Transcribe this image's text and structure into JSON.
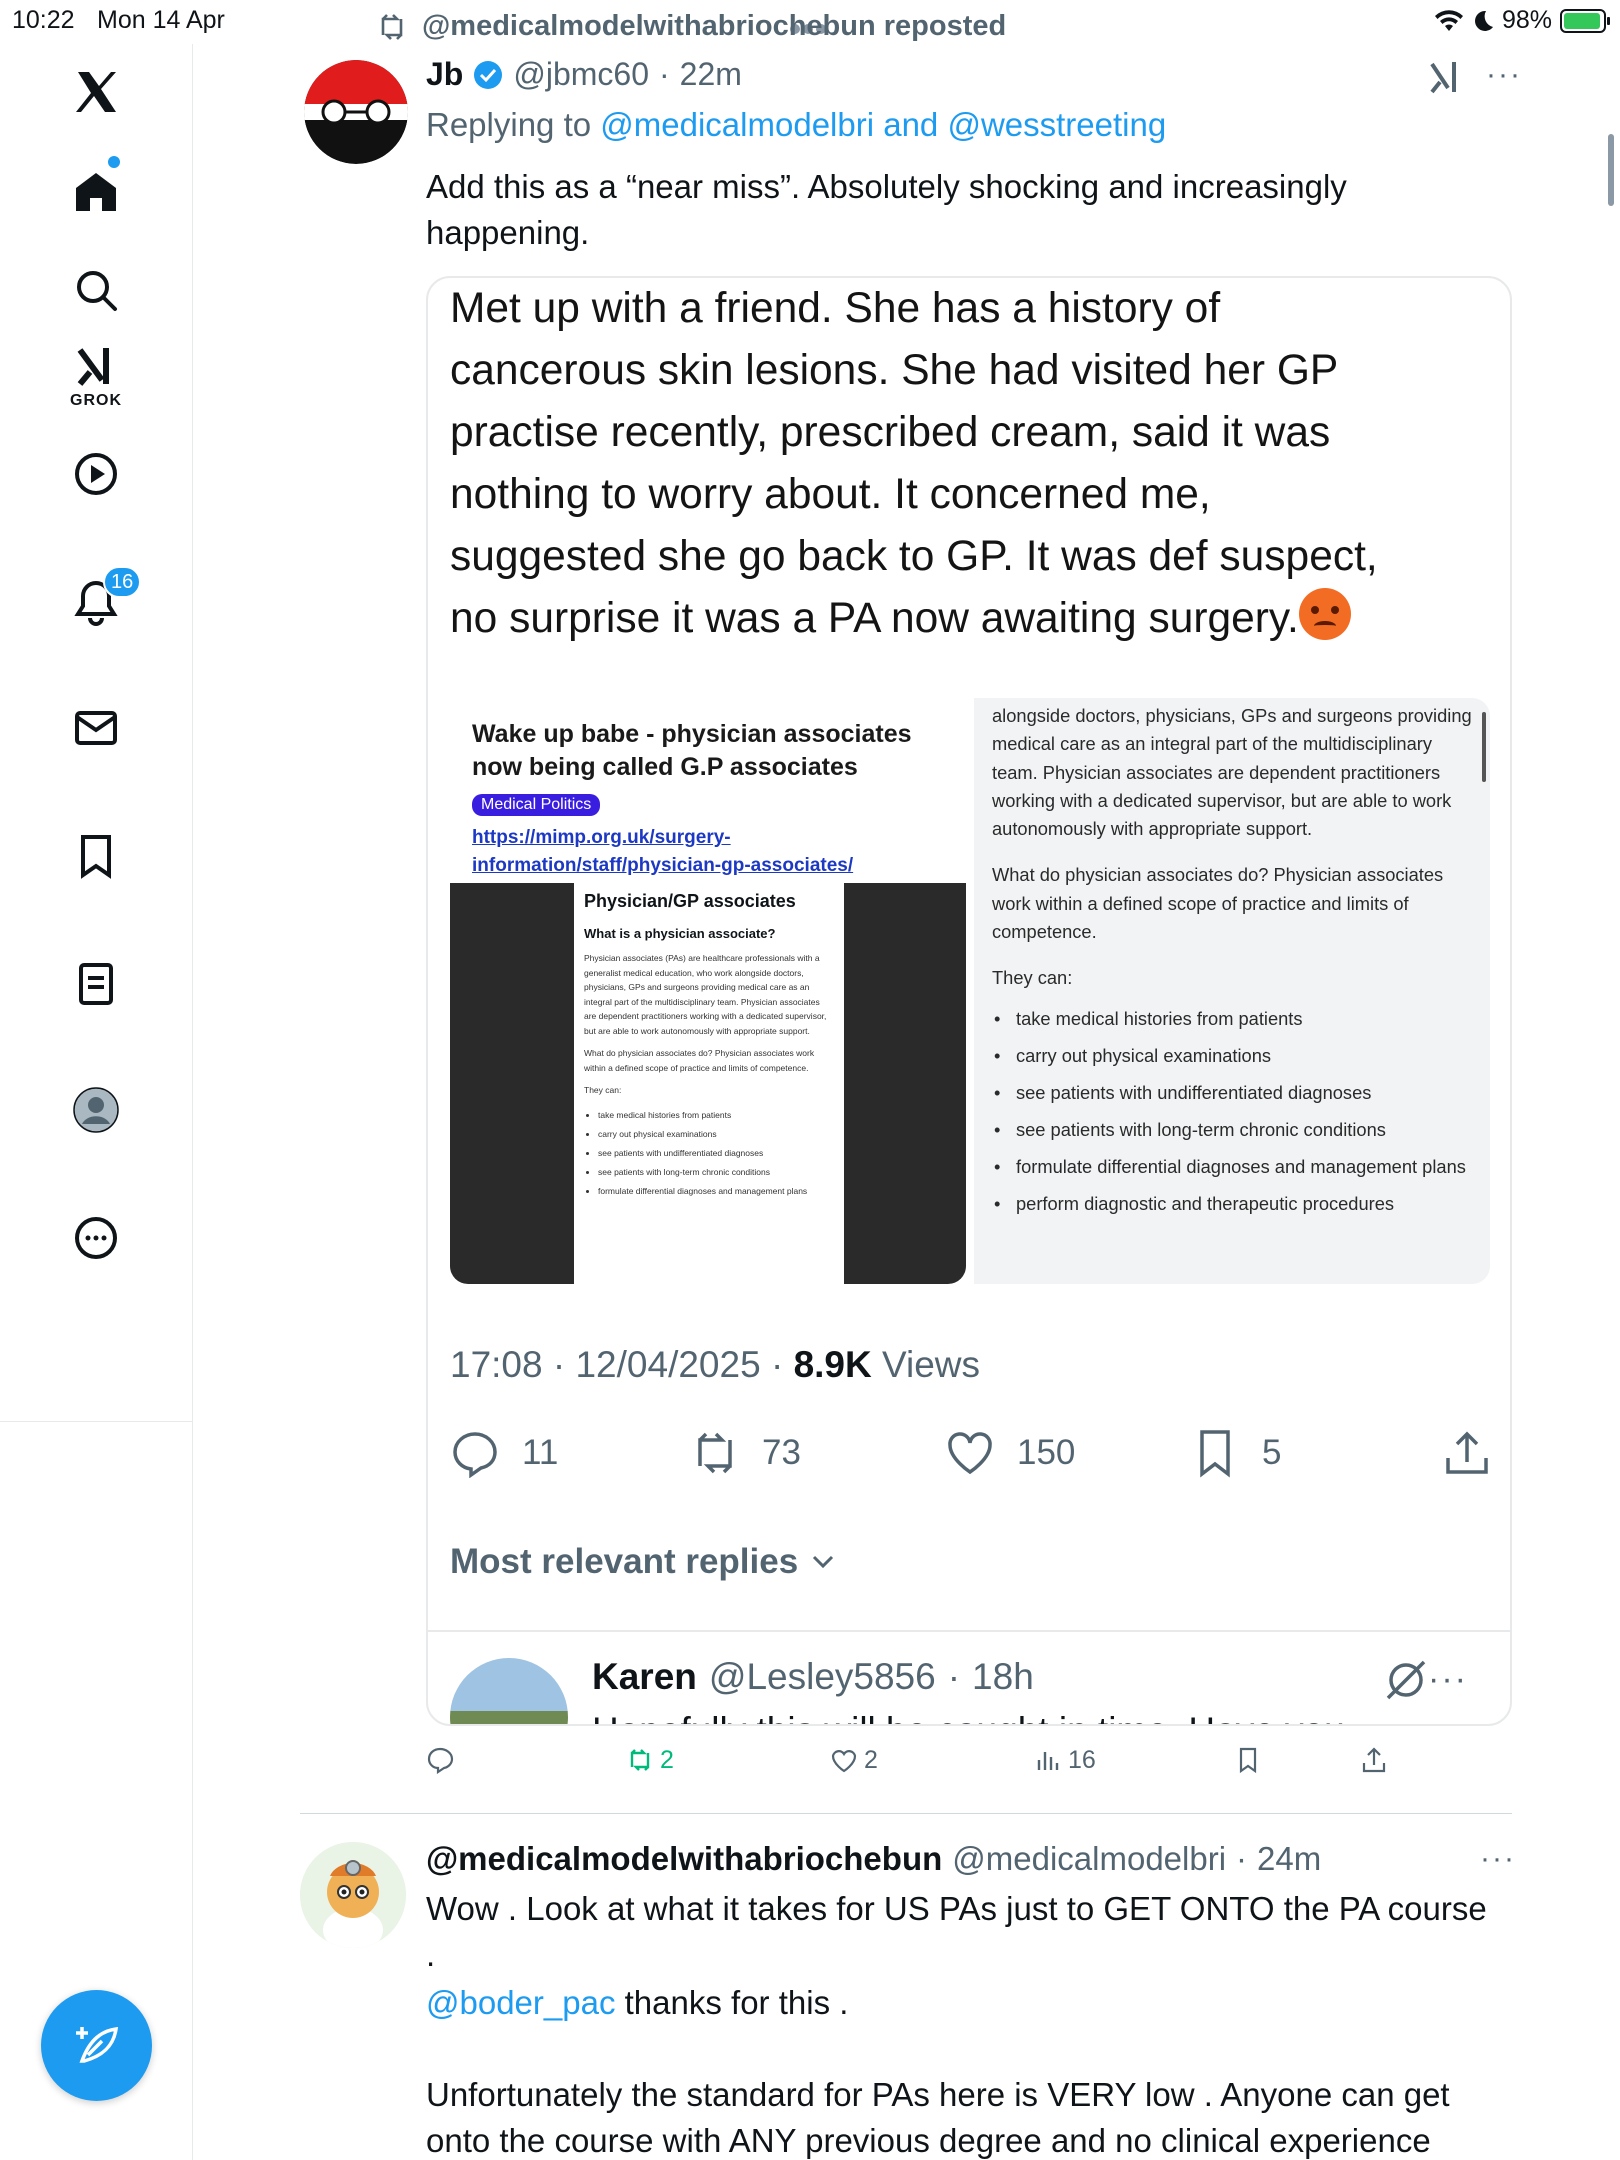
{
  "status_bar": {
    "time": "10:22",
    "date": "Mon 14 Apr",
    "battery": "98%"
  },
  "sidebar": {
    "items": [
      {
        "name": "x-logo"
      },
      {
        "name": "home"
      },
      {
        "name": "search"
      },
      {
        "name": "grok",
        "label": "GROK"
      },
      {
        "name": "video"
      },
      {
        "name": "notifications",
        "badge": "16"
      },
      {
        "name": "messages"
      },
      {
        "name": "bookmarks"
      },
      {
        "name": "lists"
      },
      {
        "name": "profile"
      },
      {
        "name": "more"
      }
    ]
  },
  "repost_banner": "@medicalmodelwithabriochebun reposted",
  "tweet1": {
    "author_name": "Jb",
    "handle": "@jbmc60",
    "time": "22m",
    "replying_prefix": "Replying to",
    "replying_to": "@medicalmodelbri and @wesstreeting",
    "text_line1": "Add this as a “near miss”. Absolutely shocking and increasingly",
    "text_line2": "happening.",
    "quote": {
      "lines": [
        "Met up with a friend. She has a history of",
        "cancerous skin lesions. She had visited her GP",
        "practise recently, prescribed cream, said it was",
        "nothing to worry about. It concerned me,",
        "suggested she go back to GP. It was def suspect,",
        "no surprise it was a PA now awaiting surgery."
      ],
      "left_image": {
        "title": "Wake up babe - physician associates now being called G.P associates",
        "badge": "Medical Politics",
        "link": "https://mimp.org.uk/surgery-information/staff/physician-gp-associates/",
        "page_heading": "Physician/GP associates",
        "page_sub": "What is a physician associate?",
        "page_p1": "Physician associates (PAs) are healthcare professionals with a generalist medical education, who work alongside doctors, physicians, GPs and surgeons providing medical care as an integral part of the multidisciplinary team. Physician associates are dependent practitioners working with a dedicated supervisor, but are able to work autonomously with appropriate support.",
        "page_p2": "What do physician associates do? Physician associates work within a defined scope of practice and limits of competence.",
        "page_p3": "They can:",
        "page_list": [
          "take medical histories from patients",
          "carry out physical examinations",
          "see patients with undifferentiated diagnoses",
          "see patients with long-term chronic conditions",
          "formulate differential diagnoses and management plans"
        ]
      },
      "right_image": {
        "p1": "alongside doctors, physicians, GPs and surgeons providing medical care as an integral part of the multidisciplinary team. Physician associates are dependent practitioners working with a dedicated supervisor, but are able to work autonomously with appropriate support.",
        "p2": "What do physician associates do? Physician associates work within a defined scope of practice and limits of competence.",
        "p3": "They can:",
        "list": [
          "take medical histories from patients",
          "carry out physical examinations",
          "see patients with undifferentiated diagnoses",
          "see patients with long-term chronic conditions",
          "formulate differential diagnoses and management plans",
          "perform diagnostic and therapeutic procedures"
        ]
      },
      "time": "17:08",
      "date": "12/04/2025",
      "views_count": "8.9K",
      "views_label": "Views",
      "replies": "11",
      "reposts": "73",
      "likes": "150",
      "bookmarks": "5",
      "most_relevant": "Most relevant replies",
      "reply_author": "Karen",
      "reply_handle": "@Lesley5856",
      "reply_time": "18h",
      "reply_text_cut": "Hopefully this will be caught in time. Have you"
    },
    "actions": {
      "replies": "",
      "reposts": "2",
      "likes": "2",
      "views": "16"
    }
  },
  "tweet2": {
    "author_name": "@medicalmodelwithabriochebun",
    "handle": "@medicalmodelbri",
    "time": "24m",
    "line1": "Wow . Look at what it takes for US PAs just to GET ONTO the PA course",
    "line2": ".",
    "mention": "@boder_pac",
    "line3_rest": " thanks for this .",
    "line4": "Unfortunately the standard for PAs here is VERY low . Anyone can get",
    "line5": "onto the course with ANY previous degree and no clinical experience"
  }
}
